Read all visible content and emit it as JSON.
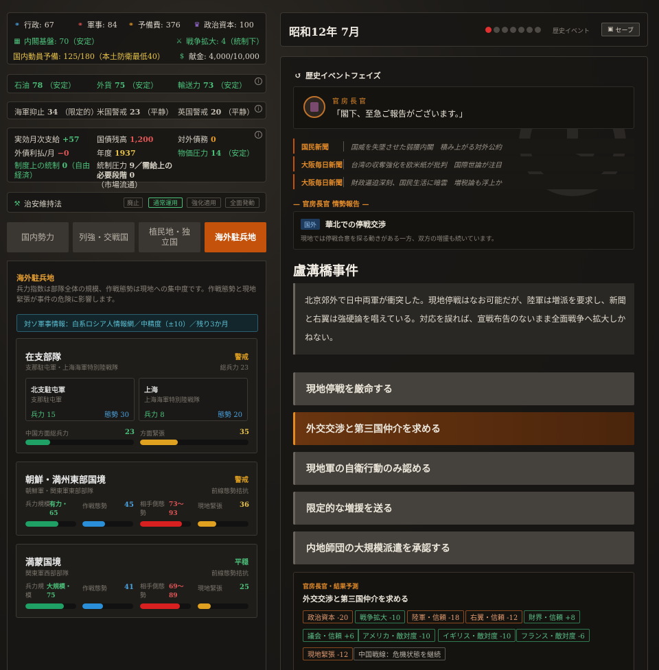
{
  "top_stats": {
    "admin": {
      "label": "行政:",
      "value": "67"
    },
    "military": {
      "label": "軍事:",
      "value": "84"
    },
    "reserve": {
      "label": "予備費:",
      "value": "376"
    },
    "political": {
      "label": "政治資本:",
      "value": "100"
    },
    "cabinet": {
      "label": "内閣基盤: 70（安定）"
    },
    "war": {
      "label": "戦争拡大: 4（統制下）"
    },
    "mobilization": {
      "label": "国内動員予備: 125/180（本土防衛最低40）"
    },
    "donation": {
      "label": "献金: 4,000/10,000"
    }
  },
  "resources": {
    "oil": {
      "label": "石油",
      "value": "78",
      "status": "（安定）"
    },
    "forex": {
      "label": "外貨",
      "value": "75",
      "status": "（安定）"
    },
    "transport": {
      "label": "輸送力",
      "value": "73",
      "status": "（安定）"
    }
  },
  "naval": {
    "restraint": {
      "label": "海軍抑止",
      "value": "34",
      "status": "（限定的）"
    },
    "us": {
      "label": "米国警戒",
      "value": "23",
      "status": "（平静）"
    },
    "uk": {
      "label": "英国警戒",
      "value": "20",
      "status": "（平静）"
    }
  },
  "finance": {
    "monthly": {
      "label": "実効月次支給",
      "value": "+57"
    },
    "bonds": {
      "label": "国債残高",
      "value": "1,200"
    },
    "foreign_debt": {
      "label": "対外債務",
      "value": "0"
    },
    "interest": {
      "label": "外債利払/月",
      "value": "−0"
    },
    "year": {
      "label": "年度",
      "value": "1937"
    },
    "price": {
      "label": "物価圧力",
      "value": "14",
      "status": "（安定）"
    },
    "control": {
      "label": "制度上の統制",
      "value": "0",
      "status": "（自由経済）"
    },
    "control_pressure": {
      "label": "統制圧力",
      "value": "9／需給上の必要段階",
      "value2": "0",
      "status": "（市場流通）"
    }
  },
  "security": {
    "title": "治安維持法",
    "modes": [
      "廃止",
      "通常運用",
      "強化適用",
      "全面発動"
    ],
    "active_mode": "通常運用"
  },
  "tabs": [
    "国内勢力",
    "列強・交戦国",
    "植民地・独立国",
    "海外駐兵地"
  ],
  "overseas": {
    "title": "海外駐兵地",
    "desc": "兵力指数は部隊全体の規模、作戦態勢は現地への集中度です。作戦態勢と現地緊張が事件の危険に影響します。",
    "intel": "対ソ軍事情報：白系ロシア人情報網／中精度（±10）／残り3か月",
    "garrisons": [
      {
        "name": "在支部隊",
        "status": "警戒",
        "sub": "支那駐屯軍・上海海軍特別陸戦隊",
        "total_label": "総兵力",
        "total": "23",
        "units": [
          {
            "name": "北支駐屯軍",
            "sub": "支那駐屯軍",
            "force_label": "兵力",
            "force": "15",
            "posture_label": "態勢",
            "posture": "30"
          },
          {
            "name": "上海",
            "sub": "上海海軍特別陸戦隊",
            "force_label": "兵力",
            "force": "8",
            "posture_label": "態勢",
            "posture": "20"
          }
        ],
        "front_label": "中国方面総兵力",
        "front": 23,
        "front_text": "23",
        "tension_label": "方面緊張",
        "tension": 35,
        "tension_text": "35"
      },
      {
        "name": "朝鮮・満州東部国境",
        "status": "警戒",
        "sub": "朝鮮軍・関東軍東部部隊",
        "right_sub": "前線態勢拮抗",
        "force_label": "兵力規模",
        "force_text": "有力・65",
        "force": 65,
        "op_label": "作戦態勢",
        "op": 45,
        "op_text": "45",
        "enemy_label": "相手側態勢",
        "enemy_text": "73〜93",
        "enemy": 83,
        "tension_label": "現地緊張",
        "tension": 36,
        "tension_text": "36"
      },
      {
        "name": "満蒙国境",
        "status": "平穏",
        "sub": "関東軍西部部隊",
        "right_sub": "前線態勢拮抗",
        "force_label": "兵力規模",
        "force_text": "大規模・75",
        "force": 75,
        "op_label": "作戦態勢",
        "op": 41,
        "op_text": "41",
        "enemy_label": "相手側態勢",
        "enemy_text": "69〜89",
        "enemy": 79,
        "tension_label": "現地緊張",
        "tension": 25,
        "tension_text": "25"
      }
    ]
  },
  "header": {
    "date": "昭和12年 7月",
    "phase_label": "歴史イベント",
    "save": "セーブ"
  },
  "event": {
    "phase_title": "歴史イベントフェイズ",
    "speaker": "官房長官",
    "quote": "「閣下、至急ご報告がございます。」",
    "news": [
      {
        "src": "国民新聞",
        "text": "国威を失墜させた弱腰内閣　積み上がる対外公約"
      },
      {
        "src": "大阪毎日新聞",
        "text": "台湾の収奪強化を欧米紙が批判　国際世論が注目"
      },
      {
        "src": "大阪毎日新聞",
        "text": "財政逼迫深刻、国民生活に暗雲　増税論も浮上か"
      }
    ],
    "report_header": "— 官房長官 情勢報告 —",
    "report_tag": "国外",
    "report_title": "華北での停戦交渉",
    "report_body": "現地では停戦合意を探る動きがある一方、双方の増援も続いています。",
    "title": "盧溝橋事件",
    "body": "北京郊外で日中両軍が衝突した。現地停戦はなお可能だが、陸軍は増派を要求し、新聞と右翼は強硬論を唱えている。対応を誤れば、宣戦布告のないまま全面戦争へ拡大しかねない。",
    "choices": [
      "現地停戦を厳命する",
      "外交交渉と第三国仲介を求める",
      "現地軍の自衛行動のみ認める",
      "限定的な増援を送る",
      "内地師団の大規模派遣を承認する"
    ],
    "selected": 1,
    "forecast_header": "官房長官・結果予測",
    "forecast_title": "外交交渉と第三国仲介を求める",
    "effects": [
      {
        "text": "政治資本 -20",
        "kind": "bad"
      },
      {
        "text": "戦争拡大 -10",
        "kind": "good"
      },
      {
        "text": "陸軍・信頼 -18",
        "kind": "bad"
      },
      {
        "text": "右翼・信頼 -12",
        "kind": "bad"
      },
      {
        "text": "財界・信頼 +8",
        "kind": "good"
      },
      {
        "text": "議会・信頼 +6",
        "kind": "good"
      },
      {
        "text": "アメリカ・敵対度 -10",
        "kind": "good"
      },
      {
        "text": "イギリス・敵対度 -10",
        "kind": "good"
      },
      {
        "text": "フランス・敵対度 -6",
        "kind": "good"
      },
      {
        "text": "現地緊張 -12",
        "kind": "bad"
      },
      {
        "text": "中国戦線：危機状態を継続",
        "kind": "neutral"
      }
    ]
  },
  "colors": {
    "accent": "#c4520a",
    "green": "#4cc07a",
    "red": "#e05555",
    "blue": "#4aa3e0",
    "amber": "#e0a020"
  }
}
